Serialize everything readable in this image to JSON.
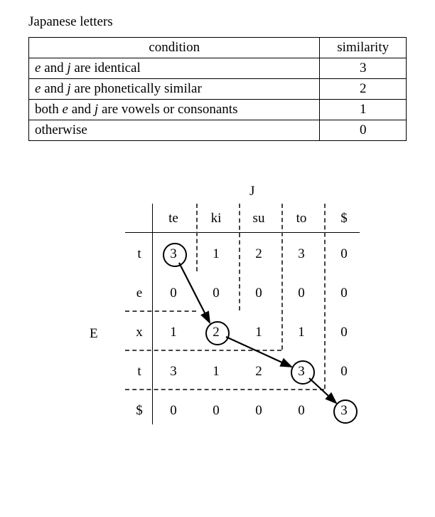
{
  "title": "Japanese letters",
  "table": {
    "header": {
      "condition": "condition",
      "similarity": "similarity"
    },
    "rows": [
      {
        "cond_pre": "",
        "cond_e": "e",
        "cond_mid": " and ",
        "cond_j": "j",
        "cond_post": " are identical",
        "sim": "3"
      },
      {
        "cond_pre": "",
        "cond_e": "e",
        "cond_mid": " and ",
        "cond_j": "j",
        "cond_post": " are phonetically similar",
        "sim": "2"
      },
      {
        "cond_pre": "both ",
        "cond_e": "e",
        "cond_mid": " and ",
        "cond_j": "j",
        "cond_post": " are vowels or consonants",
        "sim": "1"
      },
      {
        "cond_pre": "otherwise",
        "cond_e": "",
        "cond_mid": "",
        "cond_j": "",
        "cond_post": "",
        "sim": "0"
      }
    ]
  },
  "matrix": {
    "label_J": "J",
    "label_E": "E",
    "cols": [
      "te",
      "ki",
      "su",
      "to",
      "$"
    ],
    "rows": [
      "t",
      "e",
      "x",
      "t",
      "$"
    ],
    "cells": [
      [
        "3",
        "1",
        "2",
        "3",
        "0"
      ],
      [
        "0",
        "0",
        "0",
        "0",
        "0"
      ],
      [
        "1",
        "2",
        "1",
        "1",
        "0"
      ],
      [
        "3",
        "1",
        "2",
        "3",
        "0"
      ],
      [
        "0",
        "0",
        "0",
        "0",
        "3"
      ]
    ],
    "circled": [
      {
        "r": 0,
        "c": 0
      },
      {
        "r": 2,
        "c": 1
      },
      {
        "r": 3,
        "c": 3
      },
      {
        "r": 4,
        "c": 4
      }
    ]
  },
  "chart_data": {
    "type": "table",
    "description": "Dynamic-programming similarity matrix between English word E='text' and Japanese transliteration J='tekisuto', with optimal path circled and arrows showing path direction.",
    "row_labels": [
      "t",
      "e",
      "x",
      "t",
      "$"
    ],
    "col_labels": [
      "te",
      "ki",
      "su",
      "to",
      "$"
    ],
    "values": [
      [
        3,
        1,
        2,
        3,
        0
      ],
      [
        0,
        0,
        0,
        0,
        0
      ],
      [
        1,
        2,
        1,
        1,
        0
      ],
      [
        3,
        1,
        2,
        3,
        0
      ],
      [
        0,
        0,
        0,
        0,
        3
      ]
    ],
    "path": [
      [
        0,
        0
      ],
      [
        2,
        1
      ],
      [
        3,
        3
      ],
      [
        4,
        4
      ]
    ],
    "axis_E": "E",
    "axis_J": "J",
    "similarity_rules": [
      {
        "condition": "e and j are identical",
        "similarity": 3
      },
      {
        "condition": "e and j are phonetically similar",
        "similarity": 2
      },
      {
        "condition": "both e and j are vowels or consonants",
        "similarity": 1
      },
      {
        "condition": "otherwise",
        "similarity": 0
      }
    ]
  }
}
